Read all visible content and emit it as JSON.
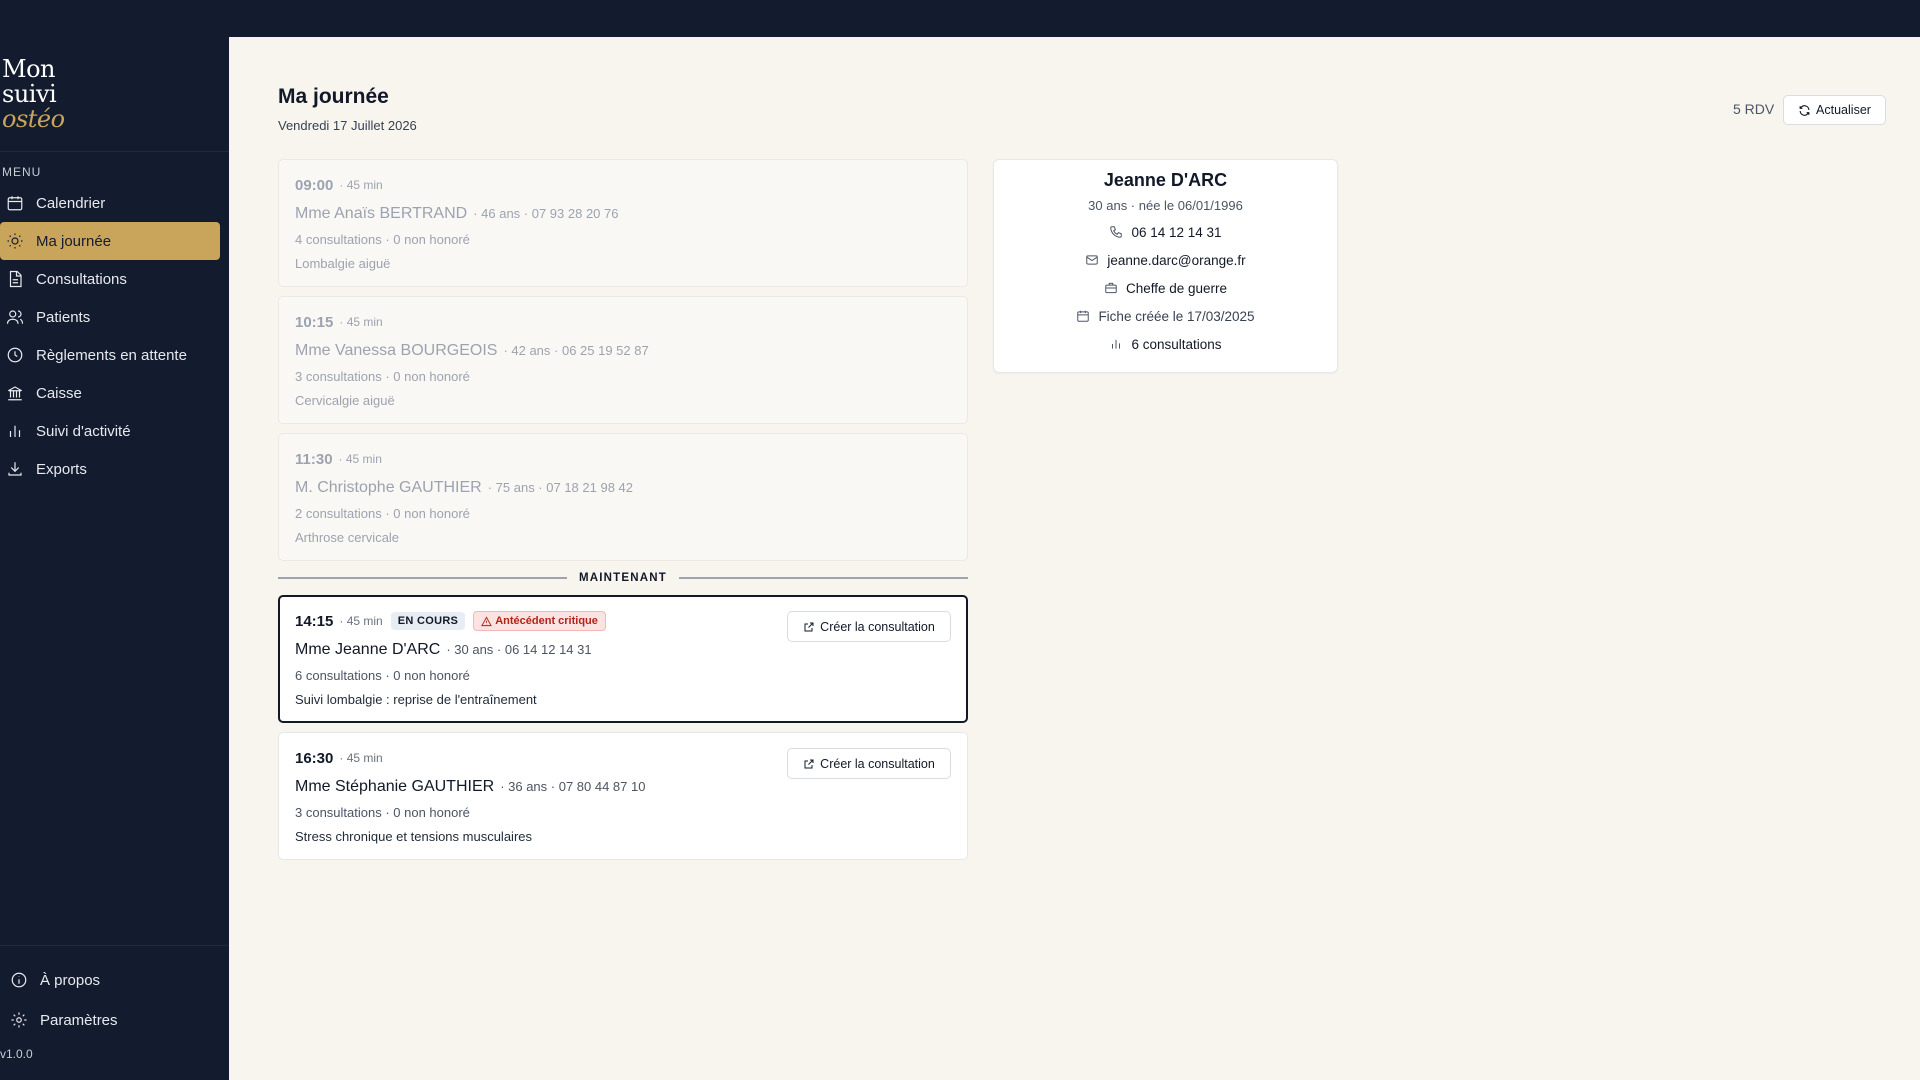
{
  "app": {
    "logo_line1": "Mon",
    "logo_line2": "suivi",
    "logo_line3": "ostéo",
    "version": "v1.0.0"
  },
  "sidebar": {
    "menu_label": "MENU",
    "items": [
      {
        "label": "Calendrier",
        "icon": "calendar-icon"
      },
      {
        "label": "Ma journée",
        "icon": "sun-icon",
        "active": true
      },
      {
        "label": "Consultations",
        "icon": "document-icon"
      },
      {
        "label": "Patients",
        "icon": "users-icon"
      },
      {
        "label": "Règlements en attente",
        "icon": "clock-icon"
      },
      {
        "label": "Caisse",
        "icon": "bank-icon"
      },
      {
        "label": "Suivi d'activité",
        "icon": "bar-chart-icon"
      },
      {
        "label": "Exports",
        "icon": "download-icon"
      }
    ],
    "bottom_items": [
      {
        "label": "À propos",
        "icon": "info-icon"
      },
      {
        "label": "Paramètres",
        "icon": "gear-icon"
      }
    ]
  },
  "header": {
    "title": "Ma journée",
    "date": "Vendredi 17 Juillet 2026",
    "rdv_count": "5 RDV",
    "refresh_label": "Actualiser"
  },
  "divider_label": "MAINTENANT",
  "appointments": [
    {
      "time": "09:00",
      "duration": "· 45 min",
      "name": "Mme Anaïs BERTRAND",
      "meta": "· 46 ans · 07 93 28 20 76",
      "stats": "4 consultations · 0 non honoré",
      "reason": "Lombalgie aiguë",
      "status": "past"
    },
    {
      "time": "10:15",
      "duration": "· 45 min",
      "name": "Mme Vanessa BOURGEOIS",
      "meta": "· 42 ans · 06 25 19 52 87",
      "stats": "3 consultations · 0 non honoré",
      "reason": "Cervicalgie aiguë",
      "status": "past"
    },
    {
      "time": "11:30",
      "duration": "· 45 min",
      "name": "M. Christophe GAUTHIER",
      "meta": "· 75 ans · 07 18 21 98 42",
      "stats": "2 consultations · 0 non honoré",
      "reason": "Arthrose cervicale",
      "status": "past"
    },
    {
      "time": "14:15",
      "duration": "· 45 min",
      "badge_status": "EN COURS",
      "badge_alert": "Antécédent critique",
      "name": "Mme Jeanne D'ARC",
      "meta": "· 30 ans · 06 14 12 14 31",
      "stats": "6 consultations · 0 non honoré",
      "reason": "Suivi lombalgie : reprise de l'entraînement",
      "action": "Créer la consultation",
      "status": "current"
    },
    {
      "time": "16:30",
      "duration": "· 45 min",
      "name": "Mme Stéphanie GAUTHIER",
      "meta": "· 36 ans · 07 80 44 87 10",
      "stats": "3 consultations · 0 non honoré",
      "reason": "Stress chronique et tensions musculaires",
      "action": "Créer la consultation",
      "status": "upcoming"
    }
  ],
  "patient_panel": {
    "name": "Jeanne D'ARC",
    "age_birth": "30 ans · née le 06/01/1996",
    "phone": "06 14 12 14 31",
    "email": "jeanne.darc@orange.fr",
    "job": "Cheffe de guerre",
    "created": "Fiche créée le 17/03/2025",
    "consultations": "6 consultations"
  },
  "colors": {
    "sidebar_bg": "#131b2e",
    "accent_gold": "#c9a55c",
    "main_bg": "#f8f5ef",
    "alert_red": "#b42318"
  }
}
